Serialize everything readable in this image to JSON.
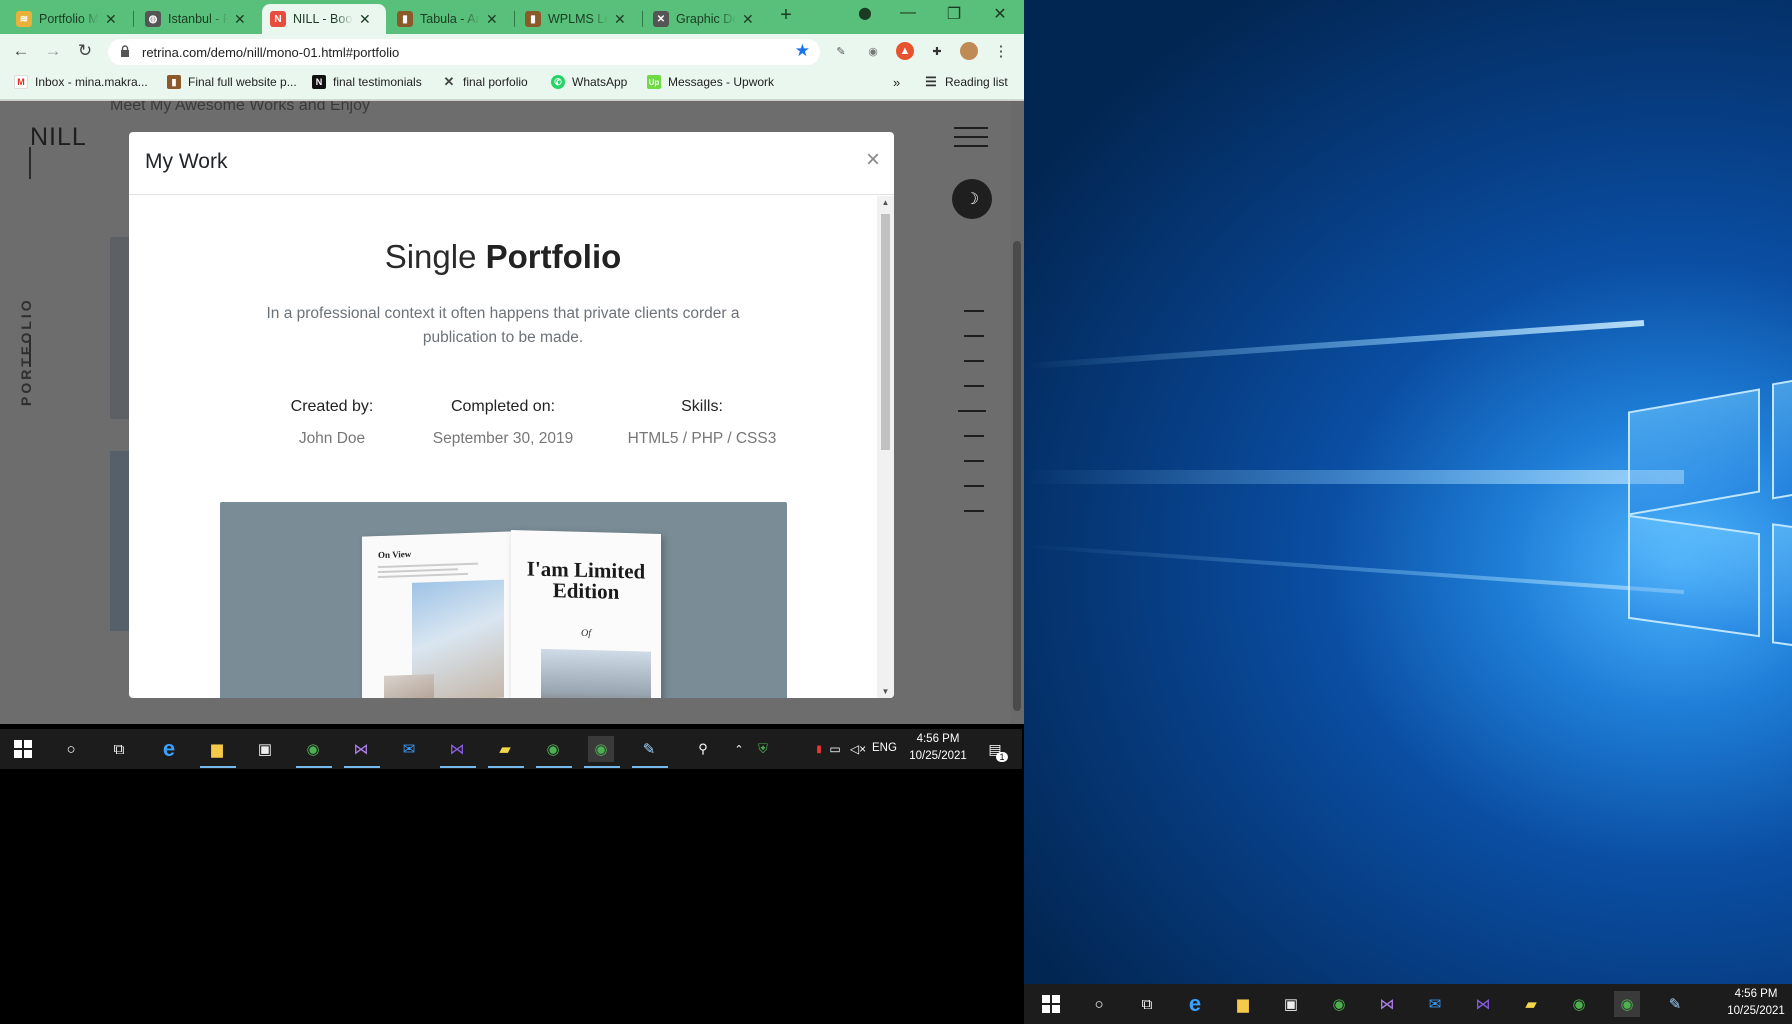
{
  "browser": {
    "tabs": [
      {
        "label": "Portfolio M",
        "favicon": "layers-favicon",
        "color": "#e8b23a"
      },
      {
        "label": "Istanbul - P",
        "favicon": "globe-favicon",
        "color": "#555555"
      },
      {
        "label": "NILL - Boot",
        "favicon": "n-favicon",
        "color": "#e74c3c",
        "active": true
      },
      {
        "label": "Tabula - Ar",
        "favicon": "book-favicon",
        "color": "#8a5a2b"
      },
      {
        "label": "WPLMS Lea",
        "favicon": "book-favicon",
        "color": "#8a5a2b"
      },
      {
        "label": "Graphic De",
        "favicon": "x-favicon",
        "color": "#555555"
      }
    ],
    "new_tab": "+",
    "url": "retrina.com/demo/nill/mono-01.html#portfolio",
    "bookmarks": [
      {
        "label": "Inbox - mina.makra...",
        "icon": "gmail-icon"
      },
      {
        "label": "Final full website p...",
        "icon": "book-icon"
      },
      {
        "label": "final testimonials",
        "icon": "n-icon"
      },
      {
        "label": "final porfolio",
        "icon": "x-icon"
      },
      {
        "label": "WhatsApp",
        "icon": "whatsapp-icon"
      },
      {
        "label": "Messages - Upwork",
        "icon": "upwork-icon"
      }
    ],
    "bookmarks_more": "»",
    "reading_list": "Reading list"
  },
  "page": {
    "subtitle": "Meet My Awesome Works and Enjoy",
    "logo": "NILL",
    "side_label": "PORTFOLIO",
    "darkmode_icon": "☽"
  },
  "modal": {
    "title": "My Work",
    "close": "×",
    "heading_light": "Single ",
    "heading_bold": "Portfolio",
    "description": "In a professional context it often happens that private clients corder a publication to be made.",
    "meta": [
      {
        "label": "Created by:",
        "value": "John Doe"
      },
      {
        "label": "Completed on:",
        "value": "September 30, 2019"
      },
      {
        "label": "Skills:",
        "value": "HTML5 / PHP / CSS3"
      }
    ],
    "image_text": {
      "left_heading": "On View",
      "right_heading": "I'am Limited Edition",
      "right_sign": "Of"
    }
  },
  "taskbar": {
    "lang": "ENG",
    "time": "4:56 PM",
    "date": "10/25/2021",
    "notif_count": "1"
  }
}
